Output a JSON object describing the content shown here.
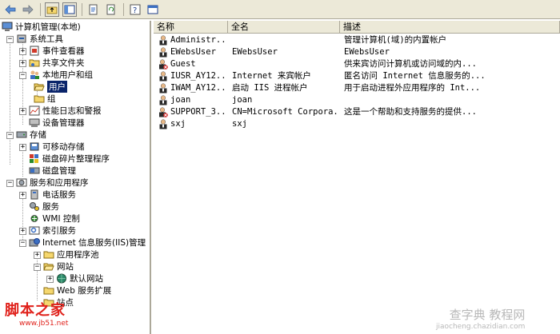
{
  "toolbar": {
    "buttons": [
      "back-arrow-icon",
      "forward-arrow-icon",
      "up-folder-icon",
      "show-hide-tree-icon",
      "export-list-icon",
      "refresh-icon",
      "help-icon",
      "properties-icon"
    ]
  },
  "tree": {
    "root": "计算机管理(本地)",
    "system_tools": "系统工具",
    "event_viewer": "事件查看器",
    "shared_folders": "共享文件夹",
    "local_users_groups": "本地用户和组",
    "users": "用户",
    "groups": "组",
    "perf_logs": "性能日志和警报",
    "device_manager": "设备管理器",
    "storage": "存储",
    "removable_storage": "可移动存储",
    "defrag": "磁盘碎片整理程序",
    "disk_mgmt": "磁盘管理",
    "services_apps": "服务和应用程序",
    "telephony": "电话服务",
    "services": "服务",
    "wmi": "WMI 控制",
    "indexing": "索引服务",
    "iis": "Internet 信息服务(IIS)管理",
    "app_pools": "应用程序池",
    "websites": "网站",
    "default_site": "默认网站",
    "web_ext": "Web 服务扩展",
    "last_item": "站点"
  },
  "list": {
    "columns": [
      "名称",
      "全名",
      "描述"
    ],
    "rows": [
      {
        "name": "Administr...",
        "fullname": "",
        "desc": "管理计算机(域)的内置帐户",
        "disabled": false
      },
      {
        "name": "EWebsUser",
        "fullname": "EWebsUser",
        "desc": "EWebsUser",
        "disabled": false
      },
      {
        "name": "Guest",
        "fullname": "",
        "desc": "供来宾访问计算机或访问域的内...",
        "disabled": true
      },
      {
        "name": "IUSR_AY12...",
        "fullname": "Internet 来宾帐户",
        "desc": "匿名访问 Internet 信息服务的...",
        "disabled": false
      },
      {
        "name": "IWAM_AY12...",
        "fullname": "启动 IIS 进程帐户",
        "desc": "用于启动进程外应用程序的 Int...",
        "disabled": false
      },
      {
        "name": "joan",
        "fullname": "joan",
        "desc": "",
        "disabled": false
      },
      {
        "name": "SUPPORT_3...",
        "fullname": "CN=Microsoft Corpora...",
        "desc": "这是一个帮助和支持服务的提供...",
        "disabled": true
      },
      {
        "name": "sxj",
        "fullname": "sxj",
        "desc": "",
        "disabled": false
      }
    ]
  },
  "watermark_left": {
    "title": "脚本之家",
    "url": "www.jb51.net"
  },
  "watermark_right": {
    "title": "查字典 教程网",
    "url": "jiaocheng.chazidian.com"
  },
  "colors": {
    "accent": "#0a246a",
    "chrome": "#ece9d8",
    "folder": "#f5d76e",
    "watermark_red": "#e0211b"
  }
}
